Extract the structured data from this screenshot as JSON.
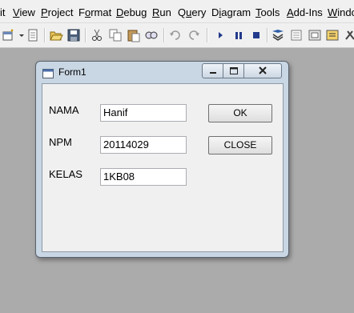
{
  "menu": [
    {
      "label": "it",
      "mnemonic": ""
    },
    {
      "label": "View",
      "mnemonic": "V"
    },
    {
      "label": "Project",
      "mnemonic": "P"
    },
    {
      "label": "Format",
      "mnemonic": "o"
    },
    {
      "label": "Debug",
      "mnemonic": "D"
    },
    {
      "label": "Run",
      "mnemonic": "R"
    },
    {
      "label": "Query",
      "mnemonic": "u"
    },
    {
      "label": "Diagram",
      "mnemonic": "i"
    },
    {
      "label": "Tools",
      "mnemonic": "T"
    },
    {
      "label": "Add-Ins",
      "mnemonic": "A"
    },
    {
      "label": "Windo",
      "mnemonic": "W"
    }
  ],
  "toolbar_icons": [
    "add-form-icon",
    "menu-editor-icon",
    "open-icon",
    "save-icon",
    "cut-icon",
    "copy-icon",
    "paste-icon",
    "find-icon",
    "undo-icon",
    "redo-icon",
    "start-icon",
    "break-icon",
    "end-icon",
    "project-explorer-icon",
    "properties-icon",
    "form-layout-icon",
    "object-browser-icon",
    "toolbox-icon"
  ],
  "form": {
    "title": "Form1",
    "fields": [
      {
        "label": "NAMA",
        "value": "Hanif"
      },
      {
        "label": "NPM",
        "value": "20114029"
      },
      {
        "label": "KELAS",
        "value": "1KB08"
      }
    ],
    "ok_label": "OK",
    "close_label": "CLOSE"
  },
  "colors": {
    "workspace": "#ababab",
    "menubar": "#f0f0f0",
    "window_frame": "#c9d6e3",
    "client_area": "#f0f0f0"
  }
}
